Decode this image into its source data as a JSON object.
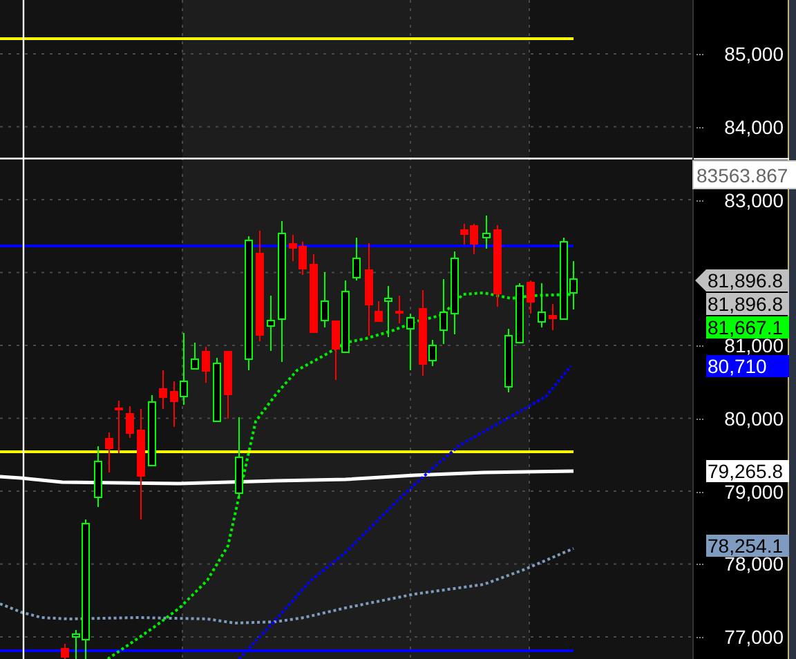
{
  "price_axis": {
    "labels": [
      "85,000",
      "84,000",
      "83,000",
      "81,000",
      "80,000",
      "79,000",
      "78,000",
      "77,000"
    ]
  },
  "crosshair": {
    "value": "83563.867"
  },
  "price_tags": [
    {
      "value": "81,896.8",
      "color": "#c0c0c0",
      "kind": "pointer"
    },
    {
      "value": "81,896.8",
      "color": "#c0c0c0",
      "kind": "plain"
    },
    {
      "value": "81,667.1",
      "color": "#00ff00",
      "kind": "plain"
    },
    {
      "value": "80,710",
      "color": "#0000ff",
      "kind": "plain"
    },
    {
      "value": "79,265.8",
      "color": "#ffffff",
      "kind": "plain"
    },
    {
      "value": "78,254.1",
      "color": "#7f9bbf",
      "kind": "plain"
    }
  ]
}
